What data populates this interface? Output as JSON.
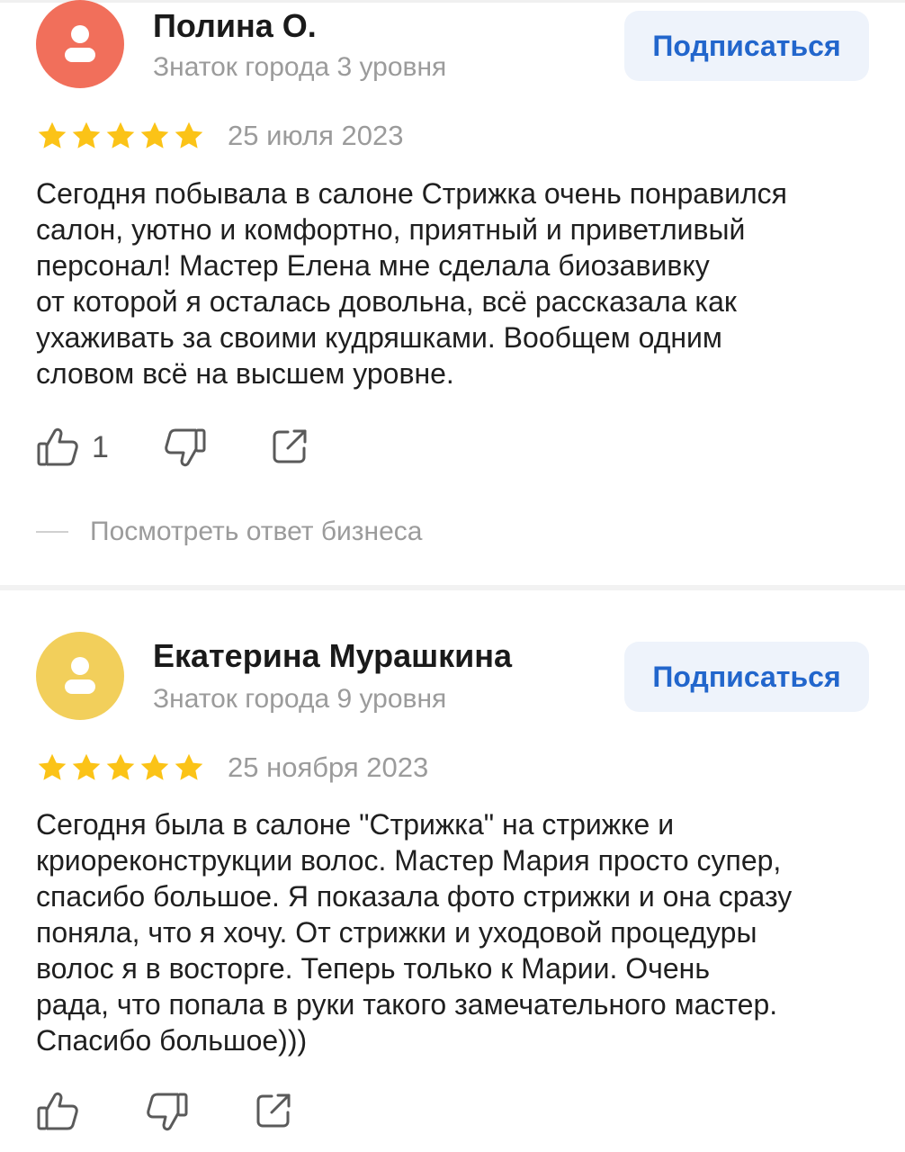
{
  "reviews": [
    {
      "author": "Полина О.",
      "level": "Знаток города 3 уровня",
      "subscribe_label": "Подписаться",
      "avatar_color": "#f16f5b",
      "rating": 5,
      "date": "25 июля 2023",
      "text_lines": [
        "Сегодня побывала в салоне Стрижка очень понравился",
        "салон, уютно и комфортно, приятный и приветливый",
        "персонал! Мастер Елена мне сделала биозавивку",
        "от которой я осталась довольна, всё рассказала как",
        "ухаживать за своими кудряшками. Вообщем одним",
        "словом всё на высшем уровне."
      ],
      "likes": "1",
      "business_reply_label": "Посмотреть ответ бизнеса"
    },
    {
      "author": "Екатерина Мурашкина",
      "level": "Знаток города 9 уровня",
      "subscribe_label": "Подписаться",
      "avatar_color": "#f2cf5b",
      "rating": 5,
      "date": "25 ноября 2023",
      "text_lines": [
        "Сегодня была в салоне \"Стрижка\" на стрижке и",
        "криореконструкции волос. Мастер Мария просто супер,",
        "спасибо большое. Я показала фото стрижки и она сразу",
        "поняла, что я хочу. От стрижки и уходовой процедуры",
        "волос я в восторге. Теперь только к Марии. Очень",
        "рада, что попала в руки такого замечательного мастер.",
        "Спасибо большое)))"
      ]
    }
  ],
  "colors": {
    "star": "#fbc317",
    "accent": "#2266cc",
    "subscribe_bg": "#eef3fb",
    "secondary_text": "#9b9b9b"
  },
  "icons": [
    "user-icon",
    "star-icon",
    "thumbs-up-icon",
    "thumbs-down-icon",
    "share-icon"
  ]
}
